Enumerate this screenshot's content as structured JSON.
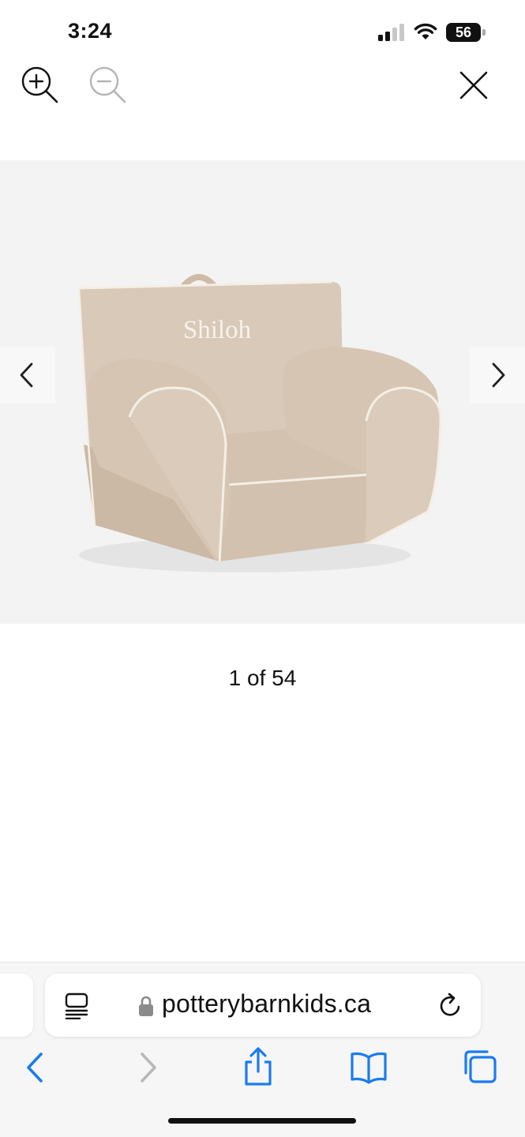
{
  "status_bar": {
    "time": "3:24",
    "battery_level": "56",
    "icons": [
      "cellular-signal-icon",
      "wifi-icon",
      "battery-icon"
    ]
  },
  "viewer": {
    "toolbar_icons": [
      "zoom-in-icon",
      "zoom-out-icon",
      "close-icon"
    ],
    "image": {
      "monogram": "Shiloh",
      "colors": {
        "background": "#f3f3f3",
        "chair": "#d6c5b3",
        "piping": "#f4efe6"
      }
    },
    "nav_icons": [
      "chevron-left-icon",
      "chevron-right-icon"
    ],
    "counter": "1 of 54"
  },
  "browser": {
    "url": "potterybarnkids.ca",
    "address_icons": [
      "reader-mode-icon",
      "lock-icon",
      "reload-icon"
    ],
    "toolbar_icons": [
      "back-icon",
      "forward-icon",
      "share-icon",
      "bookmarks-icon",
      "tabs-icon"
    ],
    "accent_color": "#1a7cf0"
  }
}
